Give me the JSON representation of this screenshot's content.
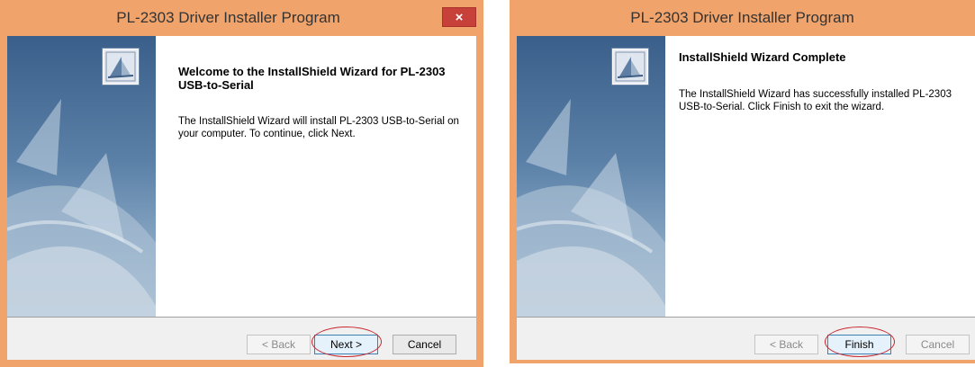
{
  "windows": [
    {
      "title": "PL-2303 Driver Installer Program",
      "close_glyph": "×",
      "heading": "Welcome to the InstallShield Wizard for PL-2303 USB-to-Serial",
      "description": "The InstallShield Wizard will install PL-2303 USB-to-Serial on your computer.  To continue, click Next.",
      "buttons": {
        "back": "< Back",
        "next": "Next >",
        "cancel": "Cancel"
      }
    },
    {
      "title": "PL-2303 Driver Installer Program",
      "heading": "InstallShield Wizard Complete",
      "description": "The InstallShield Wizard has successfully installed PL-2303 USB-to-Serial.  Click Finish to exit the wizard.",
      "buttons": {
        "back": "< Back",
        "finish": "Finish",
        "cancel": "Cancel"
      }
    }
  ],
  "colors": {
    "titlebar": "#f0a46c",
    "close_button": "#c7403a",
    "highlight_circle": "#c8262e",
    "banner_top": "#3a5f8a"
  },
  "icons": {
    "logo": "installshield-logo-icon",
    "close": "close-icon"
  }
}
